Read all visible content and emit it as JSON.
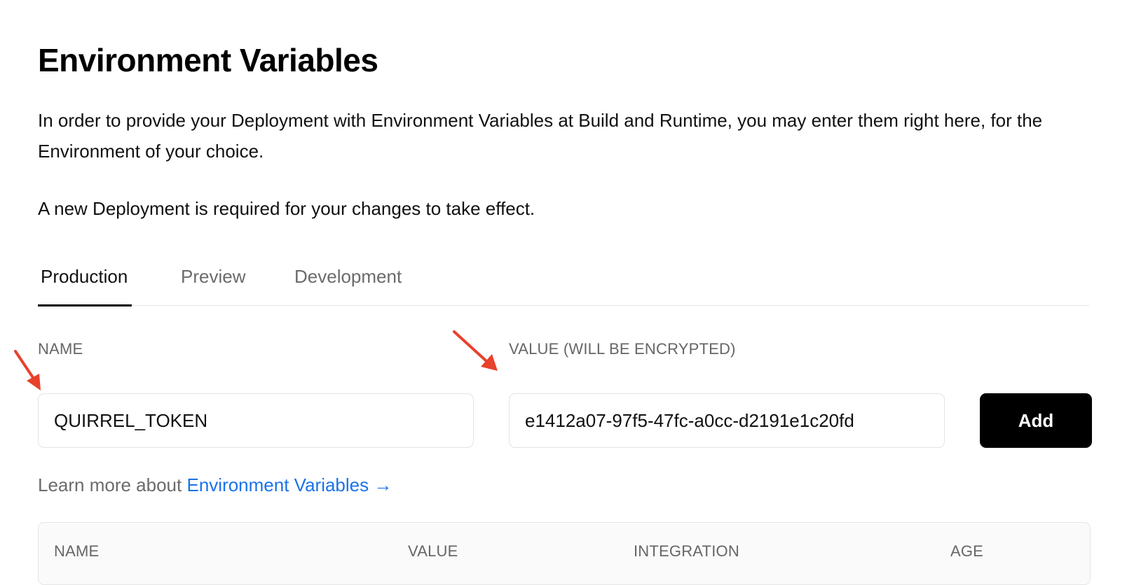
{
  "page": {
    "title": "Environment Variables",
    "description": "In order to provide your Deployment with Environment Variables at Build and Runtime, you may enter them right here, for the Environment of your choice.",
    "note": "A new Deployment is required for your changes to take effect."
  },
  "tabs": [
    {
      "label": "Production",
      "active": true
    },
    {
      "label": "Preview",
      "active": false
    },
    {
      "label": "Development",
      "active": false
    }
  ],
  "form": {
    "name_label": "NAME",
    "name_value": "QUIRREL_TOKEN",
    "value_label": "VALUE (WILL BE ENCRYPTED)",
    "value_value": "e1412a07-97f5-47fc-a0cc-d2191e1c20fd",
    "add_label": "Add"
  },
  "learn_more": {
    "prefix": "Learn more about",
    "link_text": "Environment Variables →"
  },
  "table": {
    "headers": [
      "NAME",
      "VALUE",
      "INTEGRATION",
      "AGE"
    ]
  },
  "annotations": {
    "arrow_color": "#e8412c"
  },
  "colors": {
    "primary_button": "#000000",
    "link": "#1a73e8",
    "muted_text": "#6b6b6b"
  }
}
